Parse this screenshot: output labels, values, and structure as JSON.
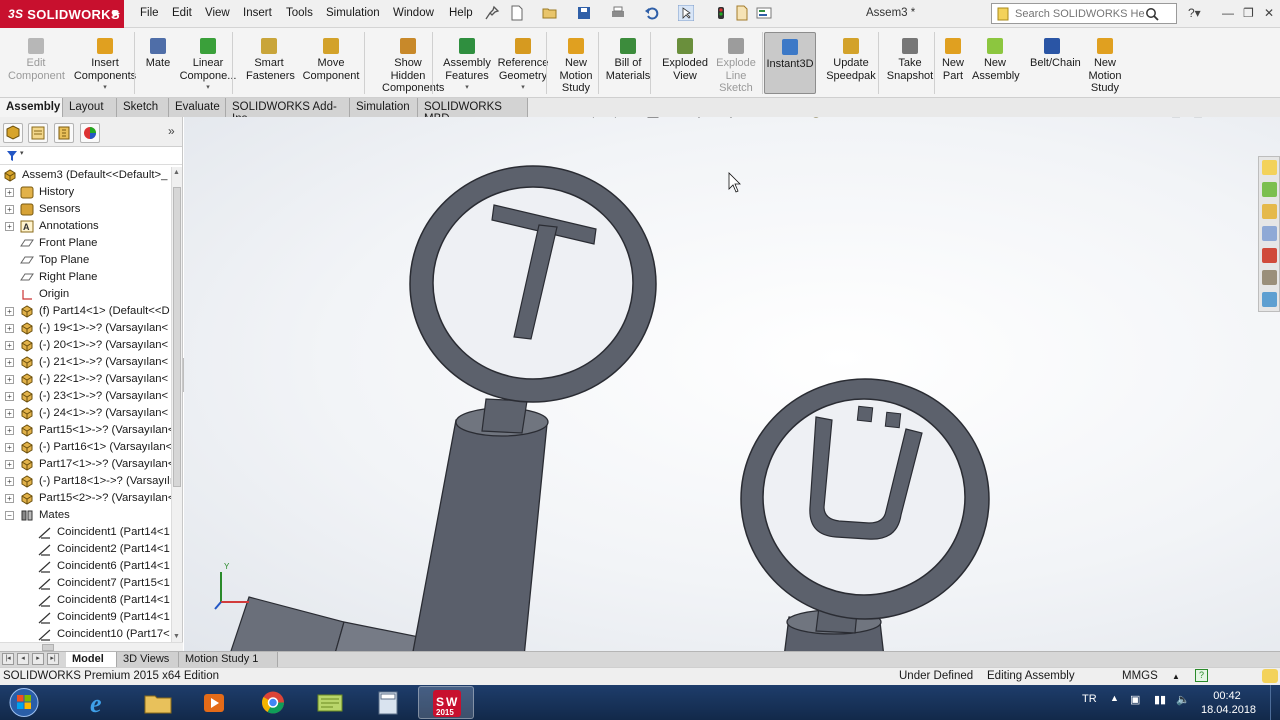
{
  "app": {
    "logo_text": "SOLIDWORKS",
    "document_title": "Assem3 *"
  },
  "menu": [
    "File",
    "Edit",
    "View",
    "Insert",
    "Tools",
    "Simulation",
    "Window",
    "Help"
  ],
  "help_search": {
    "placeholder": "Search SOLIDWORKS Help"
  },
  "commands": [
    {
      "label": "Edit\nComponent",
      "icon": "edit-component-icon",
      "enabled": false
    },
    {
      "label": "Insert\nComponents",
      "icon": "insert-components-icon",
      "enabled": true
    },
    {
      "label": "Mate",
      "icon": "mate-icon",
      "enabled": true
    },
    {
      "label": "Linear\nCompone...",
      "icon": "linear-pattern-icon",
      "enabled": true
    },
    {
      "label": "Smart\nFasteners",
      "icon": "smart-fasteners-icon",
      "enabled": true
    },
    {
      "label": "Move\nComponent",
      "icon": "move-component-icon",
      "enabled": true
    },
    {
      "label": "Show\nHidden\nComponents",
      "icon": "show-hidden-icon",
      "enabled": true
    },
    {
      "label": "Assembly\nFeatures",
      "icon": "assembly-features-icon",
      "enabled": true
    },
    {
      "label": "Reference\nGeometry",
      "icon": "reference-geometry-icon",
      "enabled": true
    },
    {
      "label": "New\nMotion\nStudy",
      "icon": "motion-study-icon",
      "enabled": true
    },
    {
      "label": "Bill of\nMaterials",
      "icon": "bom-icon",
      "enabled": true
    },
    {
      "label": "Exploded\nView",
      "icon": "exploded-view-icon",
      "enabled": true
    },
    {
      "label": "Explode\nLine\nSketch",
      "icon": "explode-line-icon",
      "enabled": false
    },
    {
      "label": "Instant3D",
      "icon": "instant3d-icon",
      "enabled": true
    },
    {
      "label": "Update\nSpeedpak",
      "icon": "speedpak-icon",
      "enabled": true
    },
    {
      "label": "Take\nSnapshot",
      "icon": "snapshot-icon",
      "enabled": true
    },
    {
      "label": "New\nPart",
      "icon": "new-part-icon",
      "enabled": true
    },
    {
      "label": "New\nAssembly",
      "icon": "new-assembly-icon",
      "enabled": true
    },
    {
      "label": "Belt/Chain",
      "icon": "belt-chain-icon",
      "enabled": true
    },
    {
      "label": "New\nMotion\nStudy",
      "icon": "motion-study-2-icon",
      "enabled": true
    }
  ],
  "cm_tabs": [
    "Assembly",
    "Layout",
    "Sketch",
    "Evaluate",
    "SOLIDWORKS Add-Ins",
    "Simulation",
    "SOLIDWORKS MBD"
  ],
  "tree": {
    "root": "Assem3  (Default<<Default>_",
    "items": [
      {
        "label": "History",
        "icon": "history-icon"
      },
      {
        "label": "Sensors",
        "icon": "sensors-icon"
      },
      {
        "label": "Annotations",
        "icon": "annotations-icon"
      },
      {
        "label": "Front Plane",
        "icon": "plane-icon"
      },
      {
        "label": "Top Plane",
        "icon": "plane-icon"
      },
      {
        "label": "Right Plane",
        "icon": "plane-icon"
      },
      {
        "label": "Origin",
        "icon": "origin-icon"
      },
      {
        "label": "(f) Part14<1> (Default<<D",
        "icon": "part-icon"
      },
      {
        "label": "(-) 19<1>->? (Varsayılan<",
        "icon": "part-icon"
      },
      {
        "label": "(-) 20<1>->? (Varsayılan<",
        "icon": "part-icon"
      },
      {
        "label": "(-) 21<1>->? (Varsayılan<",
        "icon": "part-icon"
      },
      {
        "label": "(-) 22<1>->? (Varsayılan<",
        "icon": "part-icon"
      },
      {
        "label": "(-) 23<1>->? (Varsayılan<",
        "icon": "part-icon"
      },
      {
        "label": "(-) 24<1>->? (Varsayılan<",
        "icon": "part-icon"
      },
      {
        "label": "Part15<1>->? (Varsayılan<",
        "icon": "part-icon"
      },
      {
        "label": "(-) Part16<1> (Varsayılan<",
        "icon": "part-icon"
      },
      {
        "label": "Part17<1>->? (Varsayılan<",
        "icon": "part-icon"
      },
      {
        "label": "(-) Part18<1>->? (Varsayılı",
        "icon": "part-icon"
      },
      {
        "label": "Part15<2>->? (Varsayılan<",
        "icon": "part-icon"
      },
      {
        "label": "Mates",
        "icon": "mates-icon"
      },
      {
        "label": "Coincident1 (Part14<1",
        "icon": "coincident-icon"
      },
      {
        "label": "Coincident2 (Part14<1",
        "icon": "coincident-icon"
      },
      {
        "label": "Coincident6 (Part14<1",
        "icon": "coincident-icon"
      },
      {
        "label": "Coincident7 (Part15<1",
        "icon": "coincident-icon"
      },
      {
        "label": "Coincident8 (Part14<1",
        "icon": "coincident-icon"
      },
      {
        "label": "Coincident9 (Part14<1",
        "icon": "coincident-icon"
      },
      {
        "label": "Coincident10 (Part17<",
        "icon": "coincident-icon"
      }
    ]
  },
  "bottom_tabs": [
    "Model",
    "3D Views",
    "Motion Study 1"
  ],
  "status": {
    "edition": "SOLIDWORKS Premium 2015 x64 Edition",
    "definition": "Under Defined",
    "mode": "Editing Assembly",
    "units": "MMGS"
  },
  "taskbar": {
    "lang": "TR",
    "time": "00:42",
    "date": "18.04.2018",
    "sw_badge": "2015"
  },
  "colors": {
    "brand": "#c8102e",
    "model_body": "#5f6470",
    "model_edge": "#2a2c33",
    "taskbar": "#1e3d6b"
  },
  "scene": {
    "letter_left": "T",
    "letter_right": "Ü"
  }
}
